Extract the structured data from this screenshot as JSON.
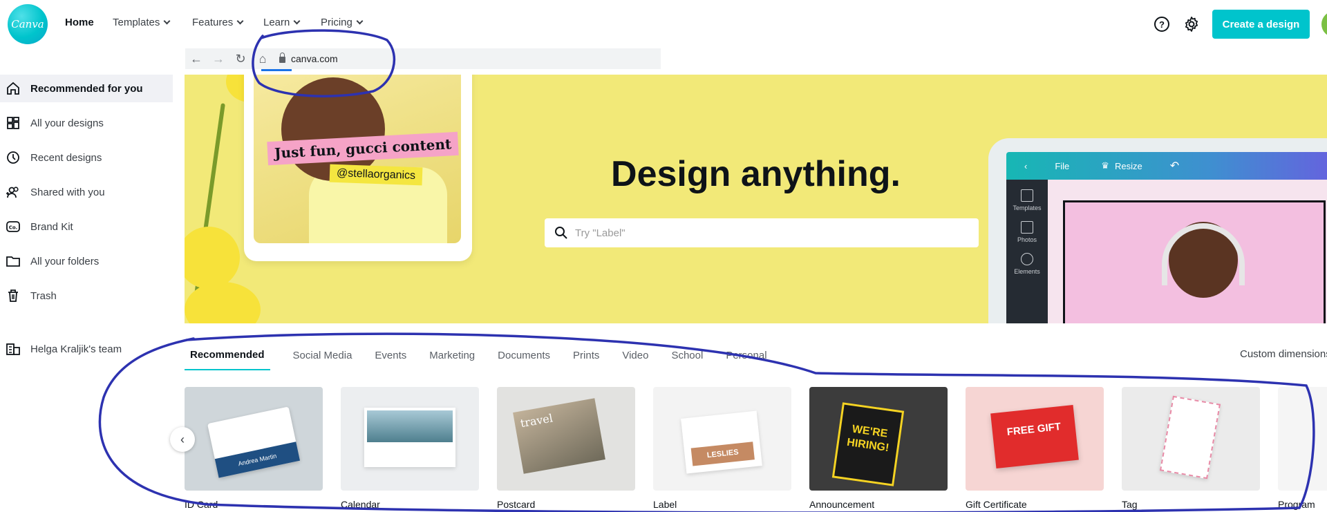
{
  "nav": {
    "logo_text": "Canva",
    "items": [
      {
        "label": "Home",
        "active": true
      },
      {
        "label": "Templates",
        "dropdown": true
      },
      {
        "label": "Features",
        "dropdown": true
      },
      {
        "label": "Learn",
        "dropdown": true
      },
      {
        "label": "Pricing",
        "dropdown": true
      }
    ],
    "help_icon": "?",
    "create_button": "Create a design"
  },
  "browser": {
    "url": "canva.com",
    "icons": [
      "back-icon",
      "forward-icon",
      "reload-icon",
      "home-icon",
      "lock-icon"
    ]
  },
  "sidebar": {
    "items": [
      {
        "label": "Recommended for you",
        "icon": "home-icon",
        "active": true
      },
      {
        "label": "All your designs",
        "icon": "grid-icon"
      },
      {
        "label": "Recent designs",
        "icon": "clock-icon"
      },
      {
        "label": "Shared with you",
        "icon": "people-icon"
      },
      {
        "label": "Brand Kit",
        "icon": "brand-kit-icon"
      },
      {
        "label": "All your folders",
        "icon": "folder-icon"
      },
      {
        "label": "Trash",
        "icon": "trash-icon"
      }
    ],
    "team": "Helga Kraljik's team"
  },
  "hero": {
    "title": "Design anything.",
    "search_placeholder": "Try \"Label\"",
    "sticker_pink": "Just fun, gucci content",
    "sticker_yellow": "@stellaorganics",
    "editor": {
      "menu": [
        "File",
        "Resize"
      ],
      "tools": [
        "Templates",
        "Photos",
        "Elements"
      ]
    }
  },
  "categories": {
    "tabs": [
      "Recommended",
      "Social Media",
      "Events",
      "Marketing",
      "Documents",
      "Prints",
      "Video",
      "School",
      "Personal"
    ],
    "active": "Recommended",
    "custom_dimensions": "Custom dimensions"
  },
  "templates": [
    {
      "label": "ID Card",
      "thumb_text": "Andrea Martin"
    },
    {
      "label": "Calendar"
    },
    {
      "label": "Postcard",
      "thumb_text": "travel"
    },
    {
      "label": "Label",
      "thumb_text": "LESLIES"
    },
    {
      "label": "Announcement",
      "thumb_text": "WE'RE HIRING!"
    },
    {
      "label": "Gift Certificate",
      "thumb_text": "FREE GIFT"
    },
    {
      "label": "Tag"
    },
    {
      "label": "Program"
    }
  ],
  "colors": {
    "brand": "#00c4cc",
    "hero_bg": "#f2e978",
    "annotation": "#2d32b0"
  }
}
